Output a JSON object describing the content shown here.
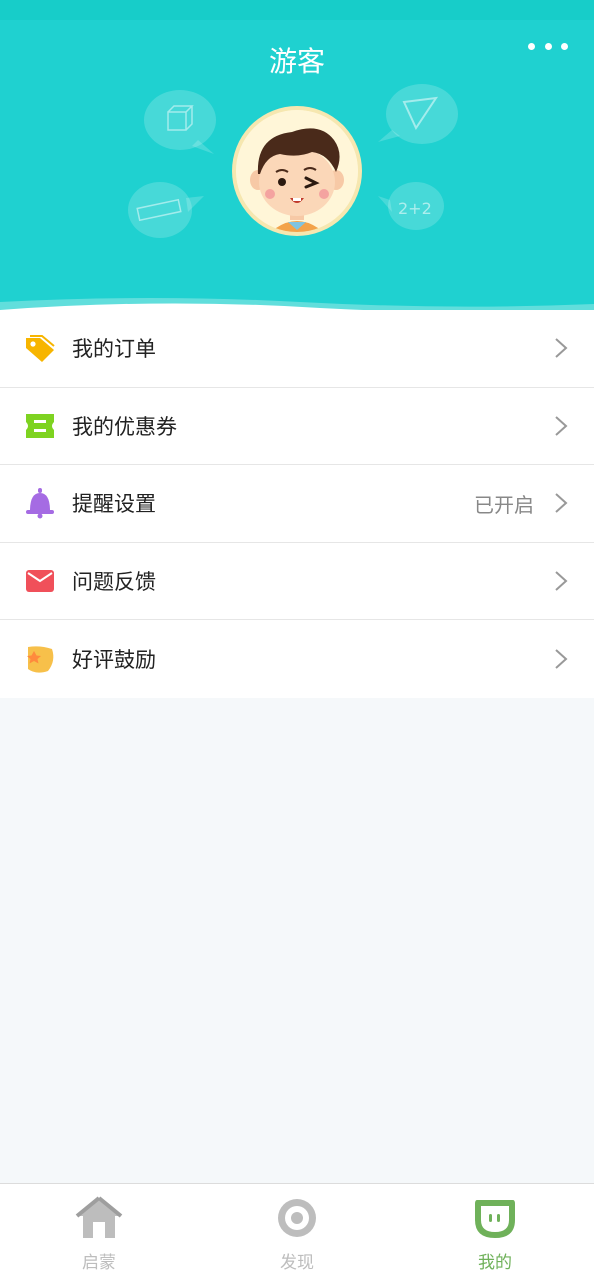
{
  "header": {
    "title": "游客",
    "more_icon": "more-dots-icon"
  },
  "menu": {
    "items": [
      {
        "label": "我的订单",
        "icon": "price-tag-icon",
        "status": ""
      },
      {
        "label": "我的优惠券",
        "icon": "coupon-icon",
        "status": ""
      },
      {
        "label": "提醒设置",
        "icon": "bell-icon",
        "status": "已开启"
      },
      {
        "label": "问题反馈",
        "icon": "mail-icon",
        "status": ""
      },
      {
        "label": "好评鼓励",
        "icon": "star-badge-icon",
        "status": ""
      }
    ]
  },
  "tabbar": {
    "tabs": [
      {
        "label": "启蒙",
        "icon": "home-icon",
        "active": false
      },
      {
        "label": "发现",
        "icon": "discover-icon",
        "active": false
      },
      {
        "label": "我的",
        "icon": "profile-icon",
        "active": true
      }
    ]
  },
  "colors": {
    "header_bg": "#1fd1d0",
    "active_tab": "#6fb15a",
    "inactive_tab": "#bdbdbd"
  }
}
